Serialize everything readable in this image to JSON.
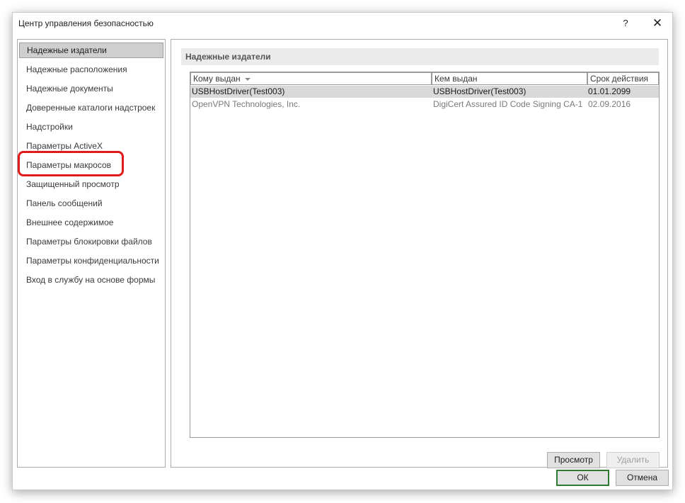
{
  "window": {
    "title": "Центр управления безопасностью",
    "help_label": "?",
    "close_label": "✕"
  },
  "sidebar": {
    "items": [
      {
        "label": "Надежные издатели",
        "selected": true
      },
      {
        "label": "Надежные расположения"
      },
      {
        "label": "Надежные документы"
      },
      {
        "label": "Доверенные каталоги надстроек"
      },
      {
        "label": "Надстройки"
      },
      {
        "label": "Параметры ActiveX"
      },
      {
        "label": "Параметры макросов",
        "highlighted": true
      },
      {
        "label": "Защищенный просмотр"
      },
      {
        "label": "Панель сообщений"
      },
      {
        "label": "Внешнее содержимое"
      },
      {
        "label": "Параметры блокировки файлов"
      },
      {
        "label": "Параметры конфиденциальности"
      },
      {
        "label": "Вход в службу на основе формы"
      }
    ]
  },
  "main": {
    "section_title": "Надежные издатели",
    "columns": [
      "Кому выдан",
      "Кем выдан",
      "Срок действия"
    ],
    "rows": [
      {
        "issued_to": "USBHostDriver(Test003)",
        "issued_by": "USBHostDriver(Test003)",
        "expires": "01.01.2099",
        "selected": true
      },
      {
        "issued_to": "OpenVPN Technologies, Inc.",
        "issued_by": "DigiCert Assured ID Code Signing CA-1",
        "expires": "02.09.2016"
      }
    ],
    "view_button": "Просмотр",
    "remove_button": "Удалить"
  },
  "footer": {
    "ok_button": "ОК",
    "cancel_button": "Отмена"
  },
  "colors": {
    "highlight_ring": "#e11a1a",
    "default_button_border": "#2e7a32",
    "selection_bg": "#d9d9d9"
  }
}
